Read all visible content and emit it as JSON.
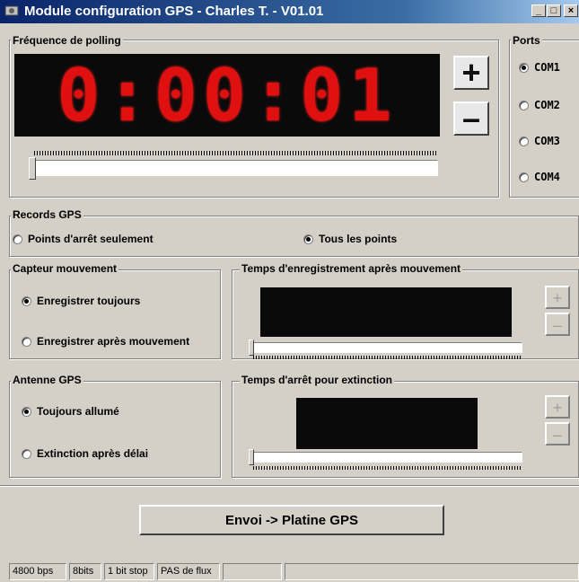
{
  "window": {
    "title": "Module configuration GPS - Charles T. - V01.01",
    "minimize_glyph": "_",
    "maximize_glyph": "□",
    "close_glyph": "×"
  },
  "polling": {
    "label": "Fréquence de polling",
    "display": "0:00:01",
    "plus": "+",
    "minus": "–"
  },
  "ports": {
    "label": "Ports",
    "items": [
      {
        "label": "COM1",
        "selected": true
      },
      {
        "label": "COM2",
        "selected": false
      },
      {
        "label": "COM3",
        "selected": false
      },
      {
        "label": "COM4",
        "selected": false
      }
    ]
  },
  "records": {
    "label": "Records GPS",
    "options": [
      {
        "label": "Points d'arrêt seulement",
        "selected": false
      },
      {
        "label": "Tous les points",
        "selected": true
      }
    ]
  },
  "capteur": {
    "label": "Capteur mouvement",
    "options": [
      {
        "label": "Enregistrer toujours",
        "selected": true
      },
      {
        "label": "Enregistrer après mouvement",
        "selected": false
      }
    ]
  },
  "temps_enreg": {
    "label": "Temps d'enregistrement après mouvement",
    "plus": "+",
    "minus": "–"
  },
  "antenne": {
    "label": "Antenne GPS",
    "options": [
      {
        "label": "Toujours allumé",
        "selected": true
      },
      {
        "label": "Extinction après délai",
        "selected": false
      }
    ]
  },
  "temps_arret": {
    "label": "Temps d'arrêt pour extinction",
    "plus": "+",
    "minus": "–"
  },
  "send_button": "Envoi -> Platine GPS",
  "status": [
    "4800 bps",
    "8bits",
    "1 bit stop",
    "PAS de flux",
    "",
    ""
  ],
  "colors": {
    "led": "#e01010",
    "titlebar": "#0a246a",
    "face": "#d4d0c8"
  }
}
